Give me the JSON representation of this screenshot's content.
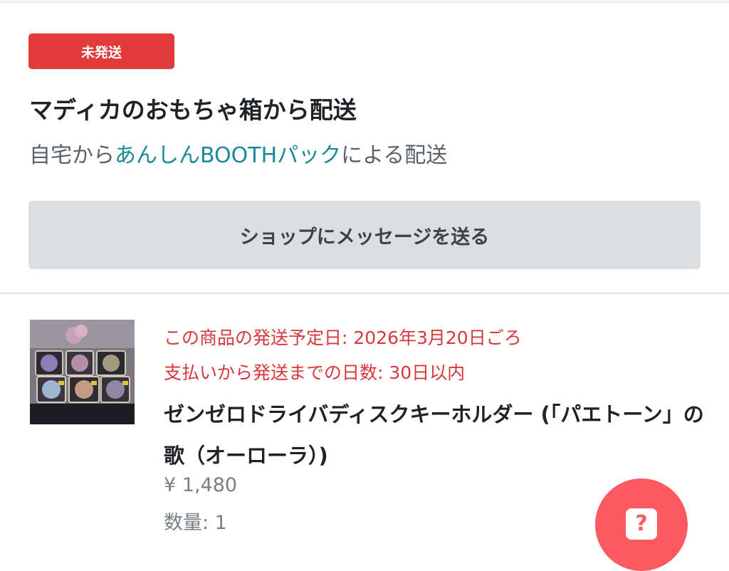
{
  "order": {
    "status_label": "未発送",
    "shop_title": "マディカのおもちゃ箱から配送",
    "shipping_prefix": "自宅から",
    "shipping_link": "あんしんBOOTHパック",
    "shipping_suffix": "による配送",
    "message_button_label": "ショップにメッセージを送る"
  },
  "item": {
    "ship_date": "この商品の発送予定日: 2026年3月20日ごろ",
    "ship_days": "支払いから発送までの日数: 30日以内",
    "name": "ゼンゼロドライバディスクキーホルダー (「パエトーン」の歌（オーローラ）)",
    "price": "¥ 1,480",
    "quantity": "数量: 1"
  },
  "help": {
    "icon_glyph": "?",
    "icon": "help-question-icon"
  },
  "colors": {
    "status_badge": "#e2393a",
    "link": "#1a8a96",
    "warning_text": "#d9373a",
    "button_bg": "#dcdee2",
    "fab": "#fb5a61"
  }
}
